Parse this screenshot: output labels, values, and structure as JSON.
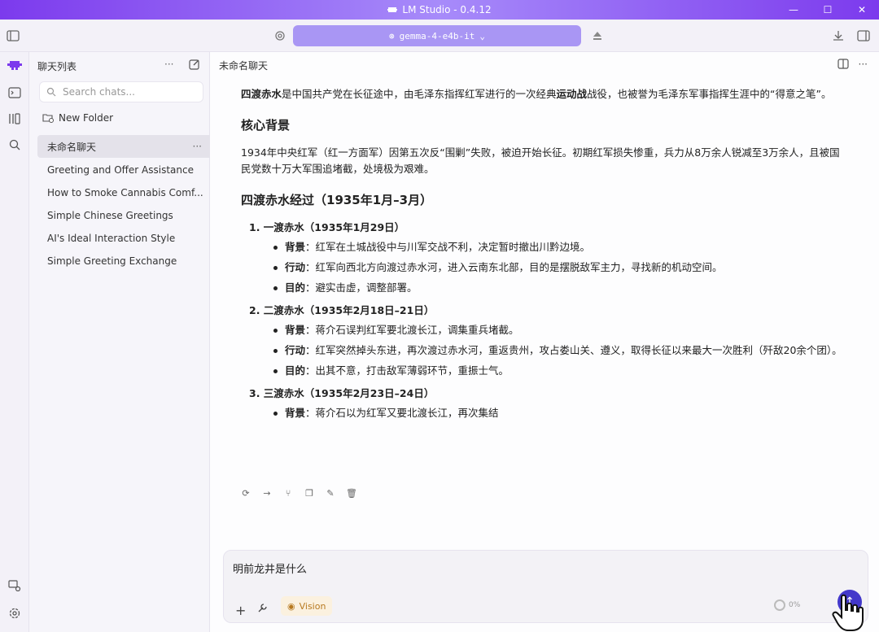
{
  "window": {
    "title": "LM Studio - 0.4.12",
    "controls": [
      "—",
      "☐",
      "✕"
    ]
  },
  "toolbar": {
    "model_name": "gemma-4-e4b-it"
  },
  "sidebar": {
    "header": "聊天列表",
    "dots": "···",
    "search_placeholder": "Search chats...",
    "new_folder": "New Folder",
    "items": [
      {
        "label": "未命名聊天"
      },
      {
        "label": "Greeting and Offer Assistance"
      },
      {
        "label": "How to Smoke Cannabis Comf..."
      },
      {
        "label": "Simple Chinese Greetings"
      },
      {
        "label": "AI's Ideal Interaction Style"
      },
      {
        "label": "Simple Greeting Exchange"
      }
    ],
    "active_more": "···"
  },
  "main": {
    "title": "未命名聊天",
    "more": "···",
    "intro_bold1": "四渡赤水",
    "intro_text1": "是中国共产党在长征途中，由毛泽东指挥红军进行的一次经典",
    "intro_bold2": "运动战",
    "intro_text2": "战役，也被誉为毛泽东军事指挥生涯中的“得意之笔”。",
    "h_background": "核心背景",
    "background_text": "1934年中央红军（红一方面军）因第五次反“围剿”失败，被迫开始长征。初期红军损失惨重，兵力从8万余人锐减至3万余人，且被国民党数十万大军围追堵截，处境极为艰难。",
    "h_course": "四渡赤水经过（1935年1月–3月）",
    "crossings": [
      {
        "title": "1. 一渡赤水（1935年1月29日）",
        "points": [
          {
            "k": "背景",
            "v": "：红军在土城战役中与川军交战不利，决定暂时撤出川黔边境。"
          },
          {
            "k": "行动",
            "v": "：红军向西北方向渡过赤水河，进入云南东北部，目的是摆脱敌军主力，寻找新的机动空间。"
          },
          {
            "k": "目的",
            "v": "：避实击虚，调整部署。"
          }
        ]
      },
      {
        "title": "2. 二渡赤水（1935年2月18日–21日）",
        "points": [
          {
            "k": "背景",
            "v": "：蒋介石误判红军要北渡长江，调集重兵堵截。"
          },
          {
            "k": "行动",
            "v": "：红军突然掉头东进，再次渡过赤水河，重返贵州，攻占娄山关、遵义，取得长征以来最大一次胜利（歼敌20余个团）。"
          },
          {
            "k": "目的",
            "v": "：出其不意，打击敌军薄弱环节，重振士气。"
          }
        ]
      },
      {
        "title": "3. 三渡赤水（1935年2月23日–24日）",
        "points": [
          {
            "k": "背景",
            "v": "：蒋介石以为红军又要北渡长江，再次集结"
          }
        ]
      }
    ]
  },
  "input": {
    "text": "明前龙井是什么",
    "vision_label": "Vision",
    "context_usage": "0%"
  }
}
